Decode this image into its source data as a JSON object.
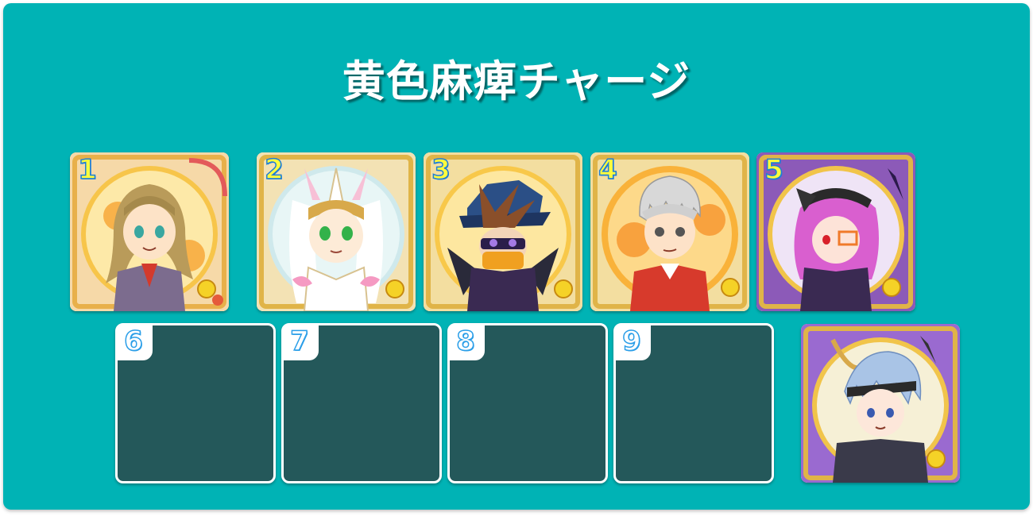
{
  "title": "黄色麻痺チャージ",
  "deck": [
    {
      "number": "1",
      "portrait": "blonde-braided-girl-card",
      "frame": "red-gold"
    },
    {
      "number": "2",
      "portrait": "white-unicorn-girl-card",
      "frame": "gold"
    },
    {
      "number": "3",
      "portrait": "masked-hat-boy-card",
      "frame": "gold"
    },
    {
      "number": "4",
      "portrait": "silver-hair-boxer-card",
      "frame": "gold"
    },
    {
      "number": "5",
      "portrait": "pink-hair-girl-card",
      "frame": "purple-gold"
    }
  ],
  "empty_slots": [
    {
      "number": "6"
    },
    {
      "number": "7"
    },
    {
      "number": "8"
    },
    {
      "number": "9"
    }
  ],
  "leader": {
    "portrait": "blue-hair-boy-card",
    "frame": "purple-gold"
  },
  "colors": {
    "background": "#00b3b5",
    "empty_slot": "#24585a",
    "number_fill": "#fffb3c",
    "number_outline": "#1e7fd6"
  }
}
